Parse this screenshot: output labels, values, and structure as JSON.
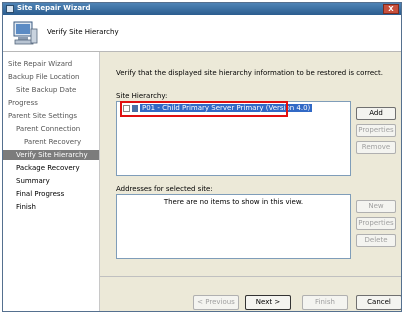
{
  "window": {
    "title": "Site Repair Wizard",
    "close_label": "X"
  },
  "header": {
    "heading": "Verify Site Hierarchy"
  },
  "steps": [
    {
      "label": "Site Repair Wizard",
      "state": "done",
      "indent": 0
    },
    {
      "label": "Backup File Location",
      "state": "done",
      "indent": 0
    },
    {
      "label": "Site Backup Date",
      "state": "done",
      "indent": 1
    },
    {
      "label": "Progress",
      "state": "done",
      "indent": 0
    },
    {
      "label": "Parent Site Settings",
      "state": "done",
      "indent": 0
    },
    {
      "label": "Parent Connection",
      "state": "done",
      "indent": 1
    },
    {
      "label": "Parent Recovery",
      "state": "done",
      "indent": 2
    },
    {
      "label": "Verify Site Hierarchy",
      "state": "active",
      "indent": 0
    },
    {
      "label": "Package Recovery",
      "state": "todo",
      "indent": 0
    },
    {
      "label": "Summary",
      "state": "todo",
      "indent": 0
    },
    {
      "label": "Final Progress",
      "state": "todo",
      "indent": 0
    },
    {
      "label": "Finish",
      "state": "todo",
      "indent": 0
    }
  ],
  "main": {
    "instruction": "Verify that the displayed site hierarchy information to be restored is correct.",
    "site_hierarchy": {
      "label": "Site Hierarchy:",
      "item": "P01 - Child Primary Server Primary (Version 4.0)",
      "buttons": {
        "add": "Add",
        "properties": "Properties",
        "remove": "Remove"
      }
    },
    "addresses": {
      "label": "Addresses for selected site:",
      "empty_message": "There are no items to show in this view.",
      "buttons": {
        "new": "New",
        "properties": "Properties",
        "delete": "Delete"
      }
    }
  },
  "footer": {
    "previous": "< Previous",
    "next": "Next >",
    "finish": "Finish",
    "cancel": "Cancel"
  }
}
